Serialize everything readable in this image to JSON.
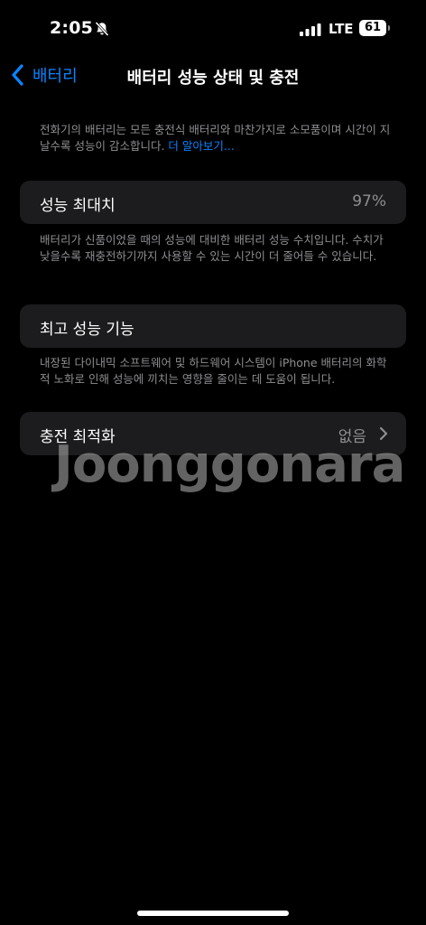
{
  "status_bar": {
    "time": "2:05",
    "network": "LTE",
    "battery_level": "61"
  },
  "nav": {
    "back_label": "배터리",
    "title": "배터리 성능 상태 및 충전"
  },
  "intro": {
    "text": "전화기의 배터리는 모든 충전식 배터리와 마찬가지로 소모품이며 시간이 지날수록 성능이 감소합니다.",
    "link": "더 알아보기..."
  },
  "max_capacity": {
    "label": "성능 최대치",
    "value": "97%",
    "description": "배터리가 신품이었을 때의 성능에 대비한 배터리 성능 수치입니다. 수치가 낮을수록 재충전하기까지 사용할 수 있는 시간이 더 줄어들 수 있습니다."
  },
  "peak_performance": {
    "label": "최고 성능 기능",
    "description": "내장된 다이내믹 소프트웨어 및 하드웨어 시스템이 iPhone 배터리의 화학적 노화로 인해 성능에 끼치는 영향을 줄이는 데 도움이 됩니다."
  },
  "charging": {
    "label": "충전 최적화",
    "value": "없음"
  },
  "watermark": "Joonggonara",
  "icons": {
    "bell": "bell-slash-icon",
    "signal": "signal-bars-icon",
    "battery": "battery-icon",
    "back": "chevron-left-icon",
    "disclosure": "chevron-right-icon"
  },
  "colors": {
    "accent": "#0a84ff",
    "background": "#000000",
    "card": "#1c1c1e",
    "secondary_text": "#8e8e93"
  }
}
